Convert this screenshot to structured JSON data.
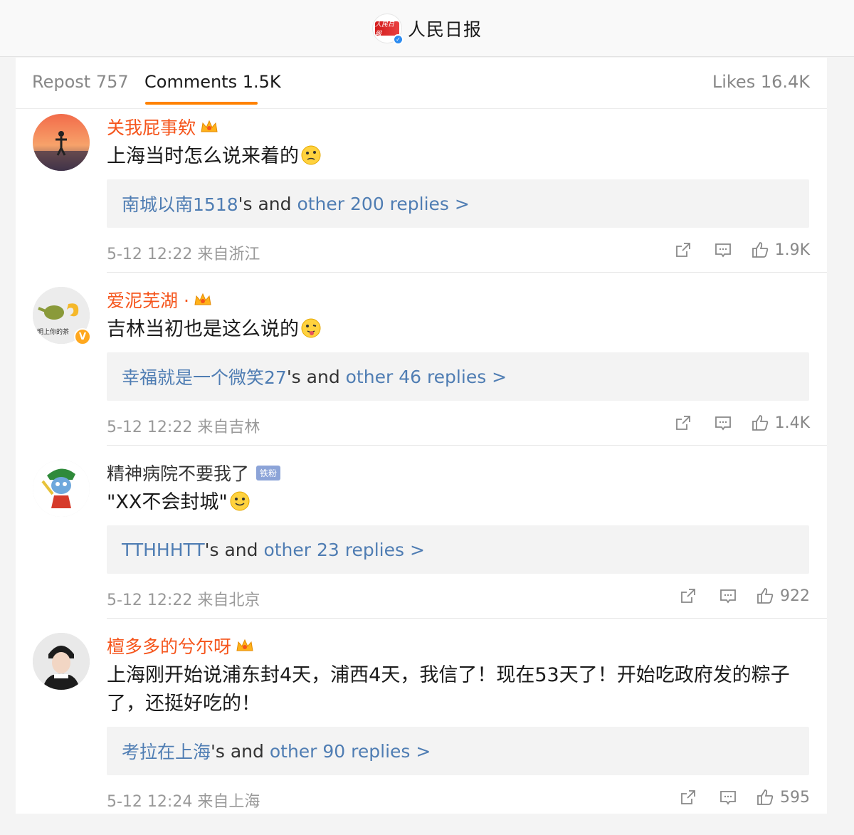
{
  "header": {
    "title": "人民日报",
    "logo_text": "人民日報"
  },
  "tabs": {
    "repost": "Repost 757",
    "comments": "Comments 1.5K",
    "likes": "Likes 16.4K"
  },
  "comments": [
    {
      "username": "关我屁事欸",
      "text": "上海当时怎么说来着的",
      "reply_user": "南城以南1518",
      "reply_mid": "'s and ",
      "reply_more": "other 200 replies >",
      "time": "5-12 12:22 来自浙江",
      "likes": "1.9K"
    },
    {
      "username": "爱泥芜湖 ·",
      "text": "吉林当初也是这么说的",
      "avatar_caption": "明上你的茶",
      "reply_user": "幸福就是一个微笑27",
      "reply_mid": "'s and ",
      "reply_more": "other 46 replies >",
      "time": "5-12 12:22 来自吉林",
      "likes": "1.4K"
    },
    {
      "username": "精神病院不要我了",
      "badge": "铁粉",
      "text": "\"XX不会封城\"",
      "reply_user": "TTHHHTT",
      "reply_mid": "'s and ",
      "reply_more": "other 23 replies >",
      "time": "5-12 12:22 来自北京",
      "likes": "922"
    },
    {
      "username": "檀多多的兮尔呀",
      "text": "上海刚开始说浦东封4天，浦西4天，我信了！现在53天了！开始吃政府发的粽子了，还挺好吃的！",
      "reply_user": "考拉在上海",
      "reply_mid": "'s and ",
      "reply_more": "other 90 replies >",
      "time": "5-12 12:24 来自上海",
      "likes": "595"
    }
  ],
  "icons": [
    "verified-icon",
    "crown-icon",
    "share-icon",
    "comment-icon",
    "thumbs-up-icon",
    "thinking-emoji-icon",
    "tongue-emoji-icon",
    "smile-emoji-icon"
  ],
  "colors": {
    "accent": "#ff8200",
    "vip_name": "#f5551c",
    "link": "#4f7db3"
  }
}
